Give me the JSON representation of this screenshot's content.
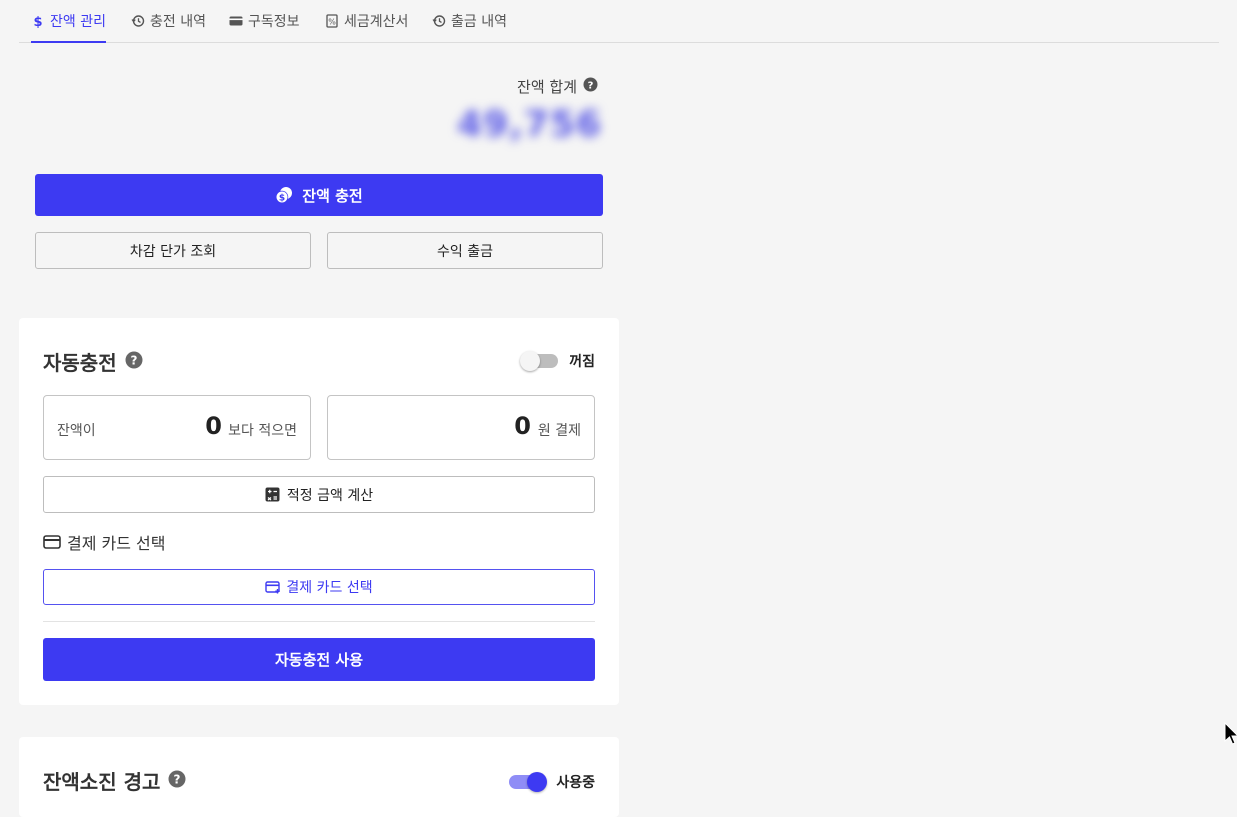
{
  "tabs": [
    {
      "label": "잔액 관리",
      "icon": "dollar-icon",
      "active": true
    },
    {
      "label": "충전 내역",
      "icon": "history-icon",
      "active": false
    },
    {
      "label": "구독정보",
      "icon": "card-icon",
      "active": false
    },
    {
      "label": "세금계산서",
      "icon": "receipt-icon",
      "active": false
    },
    {
      "label": "출금 내역",
      "icon": "history-icon",
      "active": false
    }
  ],
  "balance": {
    "label": "잔액 합계",
    "amount": "49,756",
    "charge_button": "잔액 충전",
    "price_lookup_button": "차감 단가 조회",
    "withdraw_button": "수익 출금"
  },
  "auto_charge": {
    "title": "자동충전",
    "toggle_label": "꺼짐",
    "toggle_on": false,
    "threshold_prefix": "잔액이",
    "threshold_value": "0",
    "threshold_suffix": "보다 적으면",
    "amount_value": "0",
    "amount_suffix": "원 결제",
    "calc_button": "적정 금액 계산",
    "card_section_title": "결제 카드 선택",
    "card_select_button": "결제 카드 선택",
    "enable_button": "자동충전 사용"
  },
  "low_balance_alert": {
    "title": "잔액소진 경고",
    "toggle_label": "사용중",
    "toggle_on": true
  },
  "colors": {
    "accent": "#3d3af2",
    "background": "#f5f5f5"
  }
}
